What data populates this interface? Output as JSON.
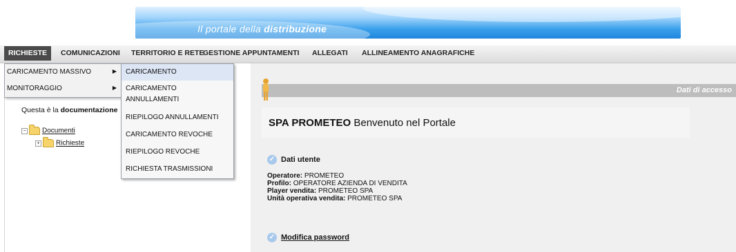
{
  "banner": {
    "title_prefix": "Il portale della",
    "title_bold": "distribuzione"
  },
  "menu": [
    {
      "label": "RICHIESTE"
    },
    {
      "label": "COMUNICAZIONI"
    },
    {
      "label": "TERRITORIO E RETE"
    },
    {
      "label": "GESTIONE APPUNTAMENTI"
    },
    {
      "label": "ALLEGATI"
    },
    {
      "label": "ALLINEAMENTO ANAGRAFICHE"
    }
  ],
  "submenu": [
    {
      "label": "CARICAMENTO MASSIVO",
      "arrow": "▶"
    },
    {
      "label": "MONITORAGGIO",
      "arrow": "▶"
    }
  ],
  "submenu2": [
    {
      "label": "CARICAMENTO"
    },
    {
      "label": "CARICAMENTO",
      "label2": "ANNULLAMENTI"
    },
    {
      "label": "RIEPILOGO ANNULLAMENTI"
    },
    {
      "label": "CARICAMENTO REVOCHE"
    },
    {
      "label": "RIEPILOGO REVOCHE"
    },
    {
      "label": "RICHIESTA TRASMISSIONI"
    }
  ],
  "left": {
    "doc_text": "Questa è la",
    "doc_text_bold": "documentazione",
    "tree": {
      "root": "Documenti",
      "child": "Richieste"
    }
  },
  "right": {
    "access_title": "Dati di accesso",
    "welcome_bold": "SPA PROMETEO",
    "welcome_rest": "Benvenuto nel Portale",
    "user_section": "Dati utente",
    "fields": [
      {
        "label": "Operatore:",
        "value": "PROMETEO"
      },
      {
        "label": "Profilo:",
        "value": "OPERATORE AZIENDA DI VENDITA"
      },
      {
        "label": "Player vendita:",
        "value": "PROMETEO SPA"
      },
      {
        "label": "Unità operativa vendita:",
        "value": "PROMETEO SPA"
      }
    ],
    "password_link": "Modifica password"
  },
  "colors": {
    "menu_active_bg": "#4a4a4a",
    "highlight": "#dde6f5"
  }
}
